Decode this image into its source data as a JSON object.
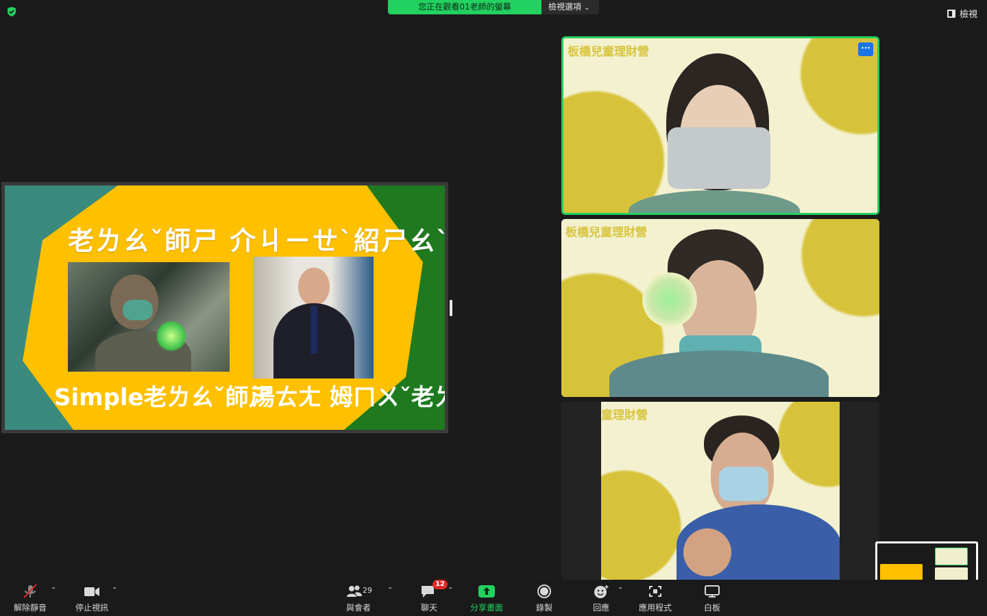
{
  "top": {
    "share_banner": "您正在觀看01老師的螢幕",
    "view_options": "檢視選項",
    "view_button": "檢視"
  },
  "slide": {
    "title": "老ㄌㄠˇ師ㄕ 介ㄐㄧㄝˋ紹ㄕㄠˋ-什ㄕㄣˊ一ㄧ 課ㄎㄜˋ",
    "teacher1_label": "Simple老ㄌㄠˇ師ㄕ",
    "teacher2_label": "湯ㄊㄤ 姆ㄇㄨˇ老ㄌㄠˇ師ㄕ"
  },
  "gallery": {
    "tile1_name": "板橋兒童理財營",
    "tile2_name": "板橋兒童理財營",
    "tile3_name": "童理財營",
    "more_label": "···"
  },
  "toolbar": {
    "unmute": "解除靜音",
    "stop_video": "停止視訊",
    "participants": "與會者",
    "participants_count": "29",
    "chat": "聊天",
    "chat_badge": "12",
    "share": "分享畫面",
    "record": "錄製",
    "reactions": "回應",
    "apps": "應用程式",
    "whiteboard": "白板"
  },
  "colors": {
    "accent_green": "#23d160",
    "slide_yellow": "#ffc000",
    "slide_green": "#1f7a1f",
    "slide_teal": "#3a8a7d",
    "tile_yellow": "#d7c33a"
  }
}
